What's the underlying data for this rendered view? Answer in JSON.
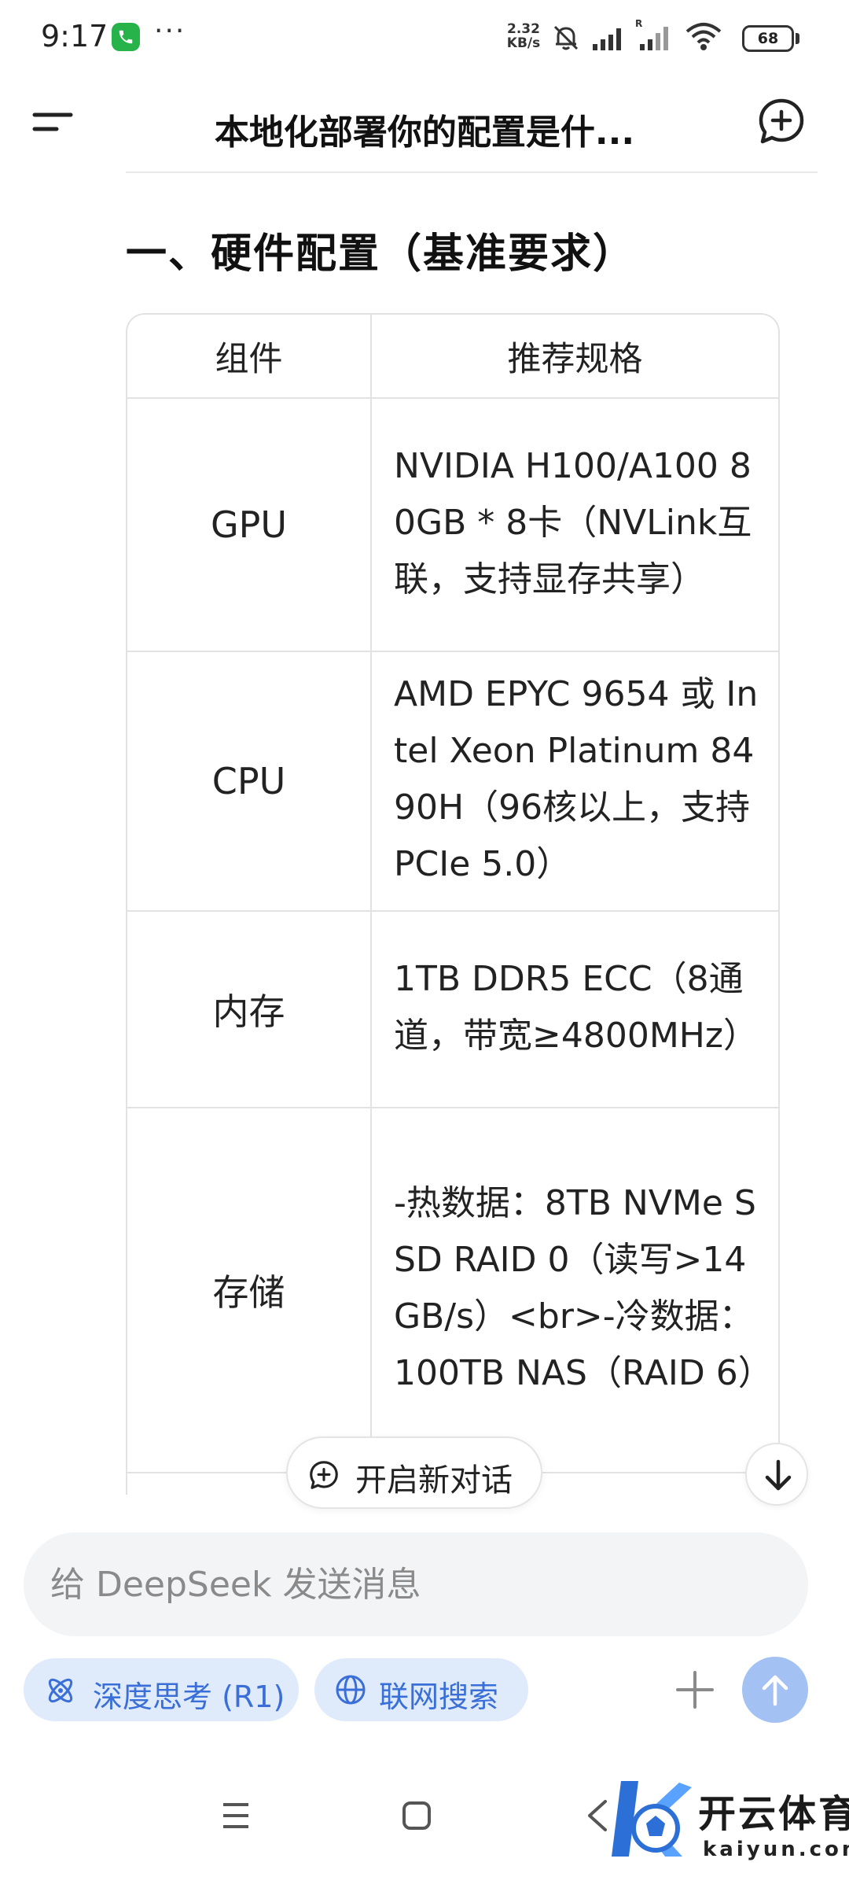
{
  "status_bar": {
    "time": "9:17",
    "more": "···",
    "net_speed_value": "2.32",
    "net_speed_unit": "KB/s",
    "battery": "68"
  },
  "header": {
    "title": "本地化部署你的配置是什..."
  },
  "content": {
    "section_heading": "一、硬件配置（基准要求）",
    "table": {
      "headers": [
        "组件",
        "推荐规格"
      ],
      "rows": [
        {
          "component": "GPU",
          "spec": "NVIDIA H100/A100 80GB * 8卡（NVLink互联，支持显存共享）"
        },
        {
          "component": "CPU",
          "spec": "AMD EPYC 9654 或 Intel Xeon Platinum 8490H（96核以上，支持PCIe 5.0）"
        },
        {
          "component": "内存",
          "spec": "1TB DDR5 ECC（8通道，带宽≥4800MHz）"
        },
        {
          "component": "存储",
          "spec": "-热数据：8TB NVMe SSD RAID 0（读写>14GB/s）<br>-冷数据：100TB NAS（RAID 6）"
        }
      ]
    }
  },
  "floating": {
    "new_chat_label": "开启新对话"
  },
  "composer": {
    "placeholder": "给 DeepSeek 发送消息",
    "deepthink_label": "深度思考 (R1)",
    "search_label": "联网搜索"
  },
  "watermark": {
    "brand": "开云体育",
    "domain": "kaiyun.com"
  },
  "colors": {
    "accent": "#3a6fd8",
    "chip_bg": "#dfeafb",
    "send_bg": "#a3c1f3",
    "call_icon": "#27b34a"
  }
}
